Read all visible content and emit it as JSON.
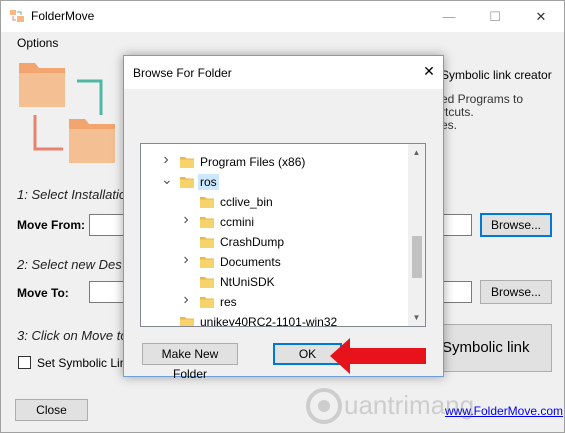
{
  "app": {
    "title": "FolderMove",
    "menu": [
      "Options"
    ]
  },
  "main": {
    "header_partial": "Symbolic link creator",
    "description_lines": [
      "ed Programs to",
      "rtcuts.",
      "es."
    ],
    "step1": "1: Select Installatio",
    "move_from_label": "Move From:",
    "move_from_value": "",
    "browse1": "Browse...",
    "step2": "2: Select new Des",
    "move_to_label": "Move To:",
    "move_to_value": "",
    "browse2": "Browse...",
    "step3": "3: Click on Move to",
    "symbolic_checkbox_label": "Set Symbolic Link",
    "create_symbolic_button": "Symbolic link",
    "close_button": "Close",
    "link": "www.FolderMove.com"
  },
  "dialog": {
    "title": "Browse For Folder",
    "close_glyph": "✕",
    "tree": [
      {
        "label": "Program Files (x86)",
        "level": 1,
        "expander": "right",
        "selected": false
      },
      {
        "label": "ros",
        "level": 1,
        "expander": "down",
        "selected": true
      },
      {
        "label": "cclive_bin",
        "level": 2,
        "expander": "none",
        "selected": false
      },
      {
        "label": "ccmini",
        "level": 2,
        "expander": "right",
        "selected": false
      },
      {
        "label": "CrashDump",
        "level": 2,
        "expander": "none",
        "selected": false
      },
      {
        "label": "Documents",
        "level": 2,
        "expander": "right",
        "selected": false
      },
      {
        "label": "NtUniSDK",
        "level": 2,
        "expander": "none",
        "selected": false
      },
      {
        "label": "res",
        "level": 2,
        "expander": "right",
        "selected": false
      },
      {
        "label": "unikey40RC2-1101-win32",
        "level": 0,
        "expander": "none",
        "selected": false
      }
    ],
    "make_new_folder": "Make New Folder",
    "ok": "OK"
  },
  "watermark": "uantrimang",
  "colors": {
    "folder": "#f7d36b",
    "folder_dark": "#e8b84a",
    "accent": "#0078d7",
    "red_arrow": "#e8121a",
    "selection": "#cce8ff"
  }
}
